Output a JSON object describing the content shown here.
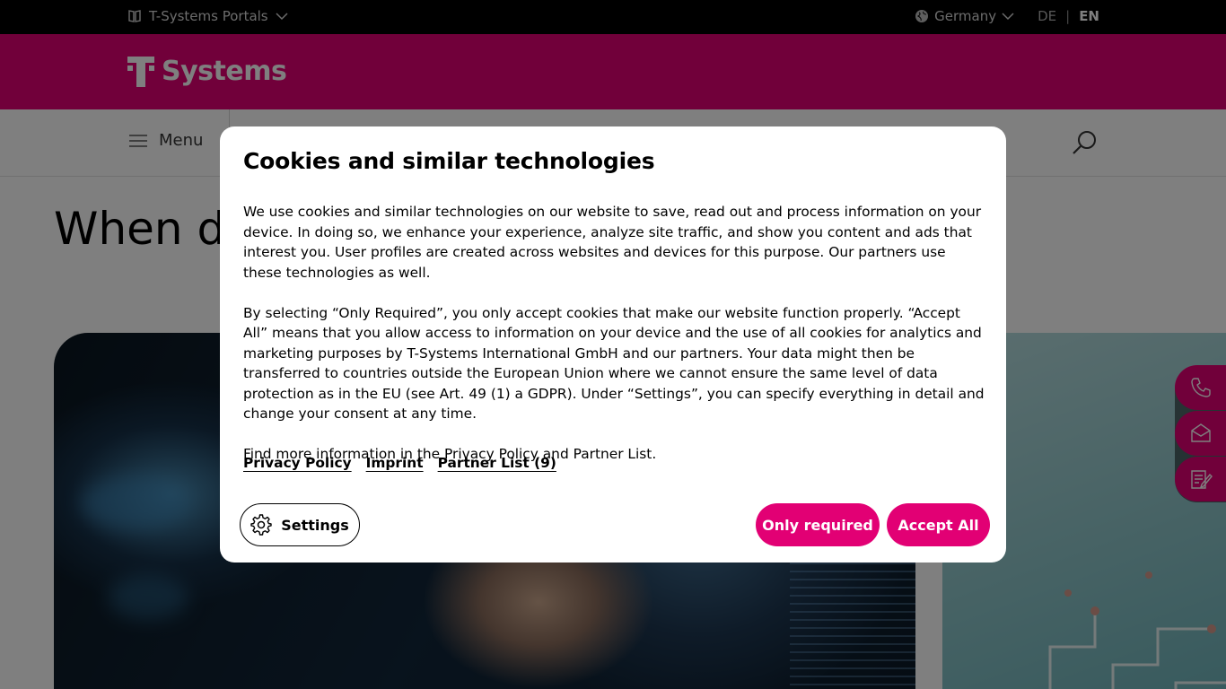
{
  "topbar": {
    "portals_label": "T-Systems Portals",
    "country_label": "Germany",
    "lang_de": "DE",
    "lang_separator": "|",
    "lang_en": "EN"
  },
  "brand": {
    "logo_text": "Systems",
    "color": "#e20074"
  },
  "nav": {
    "menu_label": "Menu"
  },
  "page": {
    "heading": "When di"
  },
  "cookie_dialog": {
    "title": "Cookies and similar technologies",
    "paragraph_1": "We use cookies and similar technologies on our website to save, read out and process information on your device. In doing so, we enhance your experience, analyze site traffic, and show you content and ads that interest you. User profiles are created across websites and devices for this purpose. Our partners use these technologies as well.",
    "paragraph_2": "By selecting “Only Required”, you only accept cookies that make our website function properly. “Accept All” means that you allow access to information on your device and the use of all cookies for analytics and marketing purposes by T-Systems International GmbH and our partners. Your data might then be transferred to countries outside the European Union where we cannot ensure the same level of data protection as in the EU (see Art. 49 (1) a GDPR). Under “Settings”, you can specify everything in detail and change your consent at any time.",
    "paragraph_3": "Find more information in the Privacy Policy and Partner List.",
    "links": {
      "privacy": "Privacy Policy",
      "imprint": "Imprint",
      "partners": "Partner List (9)"
    },
    "settings_label": "Settings",
    "only_required_label": "Only required",
    "accept_all_label": "Accept All"
  },
  "side_tabs": [
    "phone-icon",
    "mail-icon",
    "form-icon"
  ]
}
